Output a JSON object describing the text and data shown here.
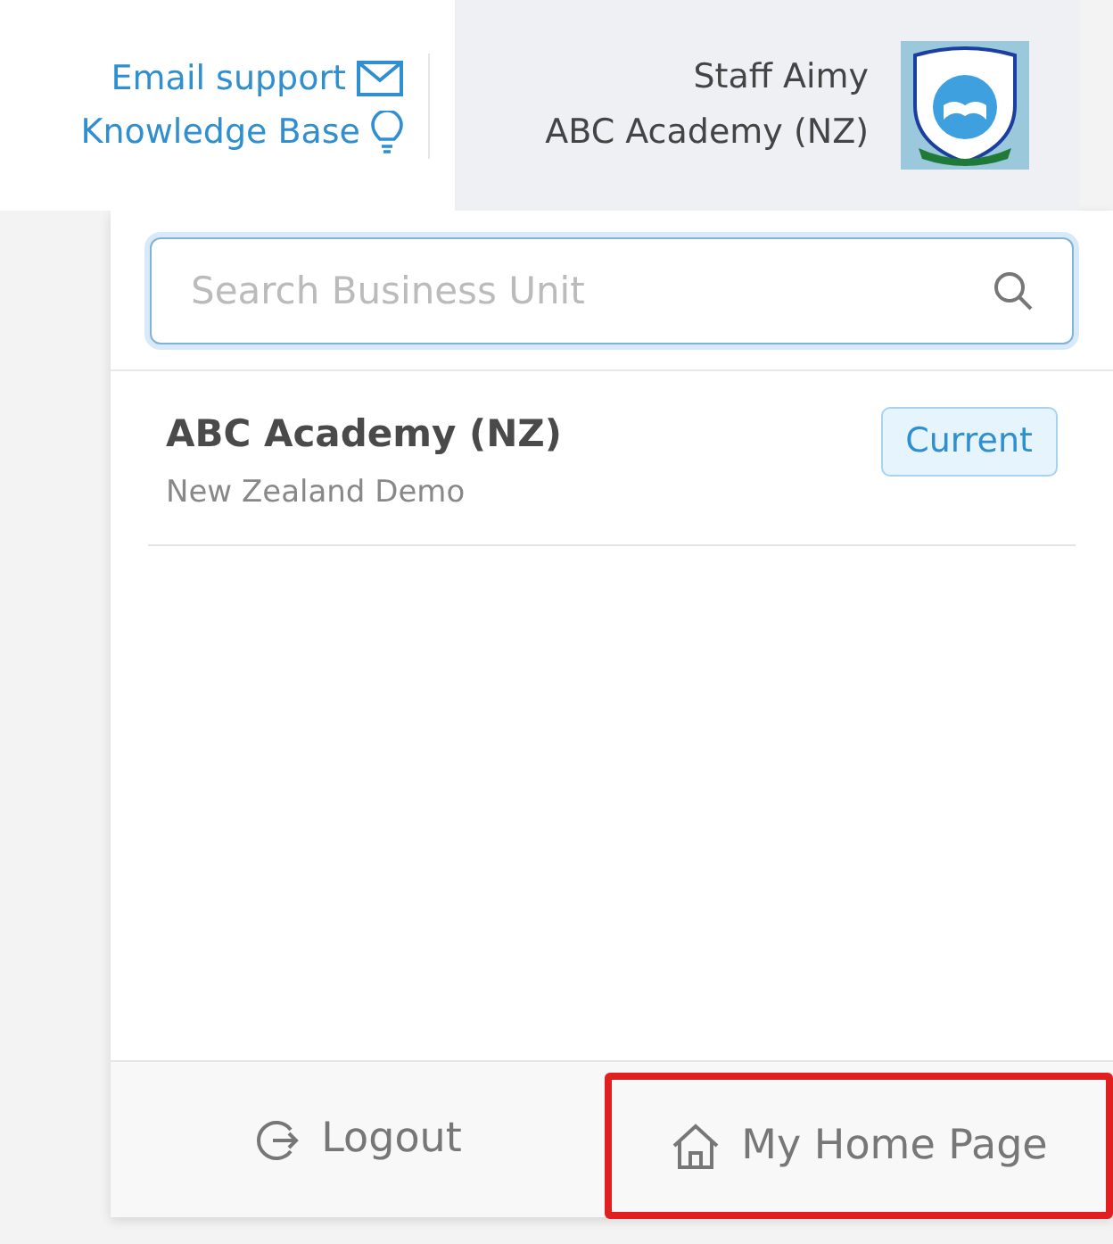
{
  "header": {
    "links": [
      {
        "kind": "email",
        "label": "Email support"
      },
      {
        "kind": "idea",
        "label": "Knowledge Base"
      }
    ],
    "user": {
      "name": "Staff Aimy",
      "organisation": "ABC Academy (NZ)"
    }
  },
  "dropdown": {
    "search": {
      "placeholder": "Search Business Unit"
    },
    "units": [
      {
        "name": "ABC Academy (NZ)",
        "subtitle": "New Zealand Demo",
        "badge": "Current"
      }
    ],
    "footer": [
      {
        "kind": "logout",
        "label": "Logout",
        "highlighted": false
      },
      {
        "kind": "home",
        "label": "My Home Page",
        "highlighted": true
      }
    ]
  }
}
